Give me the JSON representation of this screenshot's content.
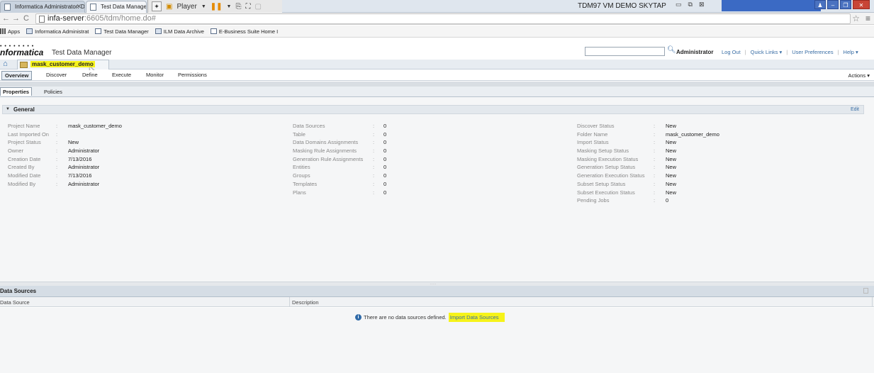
{
  "browser": {
    "tabs": [
      {
        "label": "Informatica Administrator: D"
      },
      {
        "label": "Test Data Manager"
      }
    ],
    "player_label": "Player",
    "vm_title": "TDM97 VM DEMO SKYTAP",
    "url_host": "infa-server",
    "url_path": ":6605/tdm/home.do#",
    "bookmarks": [
      {
        "label": "Apps"
      },
      {
        "label": "Informatica Administrat"
      },
      {
        "label": "Test Data Manager"
      },
      {
        "label": "ILM Data Archive"
      },
      {
        "label": "E-Business Suite Home I"
      }
    ]
  },
  "header": {
    "logo": "nformatica",
    "product": "Test Data Manager",
    "user": "Administrator",
    "links": [
      "Log Out",
      "Quick Links ▾",
      "User Preferences",
      "Help ▾"
    ]
  },
  "project_tab": {
    "name": "mask_customer_demo"
  },
  "subnav": {
    "items": [
      "Overview",
      "Discover",
      "Define",
      "Execute",
      "Monitor",
      "Permissions"
    ],
    "actions": "Actions ▾"
  },
  "props_tabs": [
    "Properties",
    "Policies"
  ],
  "general": {
    "title": "General",
    "edit": "Edit",
    "col1": [
      {
        "label": "Project Name",
        "value": "mask_customer_demo"
      },
      {
        "label": "Last Imported On",
        "value": ""
      },
      {
        "label": "Project Status",
        "value": "New"
      },
      {
        "label": "Owner",
        "value": "Administrator"
      },
      {
        "label": "Creation Date",
        "value": "7/13/2016"
      },
      {
        "label": "Created By",
        "value": "Administrator"
      },
      {
        "label": "Modified Date",
        "value": "7/13/2016"
      },
      {
        "label": "Modified By",
        "value": "Administrator"
      }
    ],
    "col2": [
      {
        "label": "Data Sources",
        "value": "0"
      },
      {
        "label": "Table",
        "value": "0"
      },
      {
        "label": "Data Domains Assignments",
        "value": "0"
      },
      {
        "label": "Masking Rule Assignments",
        "value": "0"
      },
      {
        "label": "Generation Rule Assignments",
        "value": "0"
      },
      {
        "label": "Entities",
        "value": "0"
      },
      {
        "label": "Groups",
        "value": "0"
      },
      {
        "label": "Templates",
        "value": "0"
      },
      {
        "label": "Plans",
        "value": "0"
      }
    ],
    "col3": [
      {
        "label": "Discover Status",
        "value": "New"
      },
      {
        "label": "Folder Name",
        "value": "mask_customer_demo"
      },
      {
        "label": "Import Status",
        "value": "New"
      },
      {
        "label": "Masking Setup Status",
        "value": "New"
      },
      {
        "label": "Masking Execution Status",
        "value": "New"
      },
      {
        "label": "Generation Setup Status",
        "value": "New"
      },
      {
        "label": "Generation Execution Status",
        "value": "New"
      },
      {
        "label": "Subset Setup Status",
        "value": "New"
      },
      {
        "label": "Subset Execution Status",
        "value": "New"
      },
      {
        "label": "Pending Jobs",
        "value": "0"
      }
    ]
  },
  "data_sources": {
    "title": "Data Sources",
    "columns": [
      "Data Source",
      "Description"
    ],
    "empty_message": "There are no data sources defined.",
    "import_link": "Import Data Sources"
  }
}
